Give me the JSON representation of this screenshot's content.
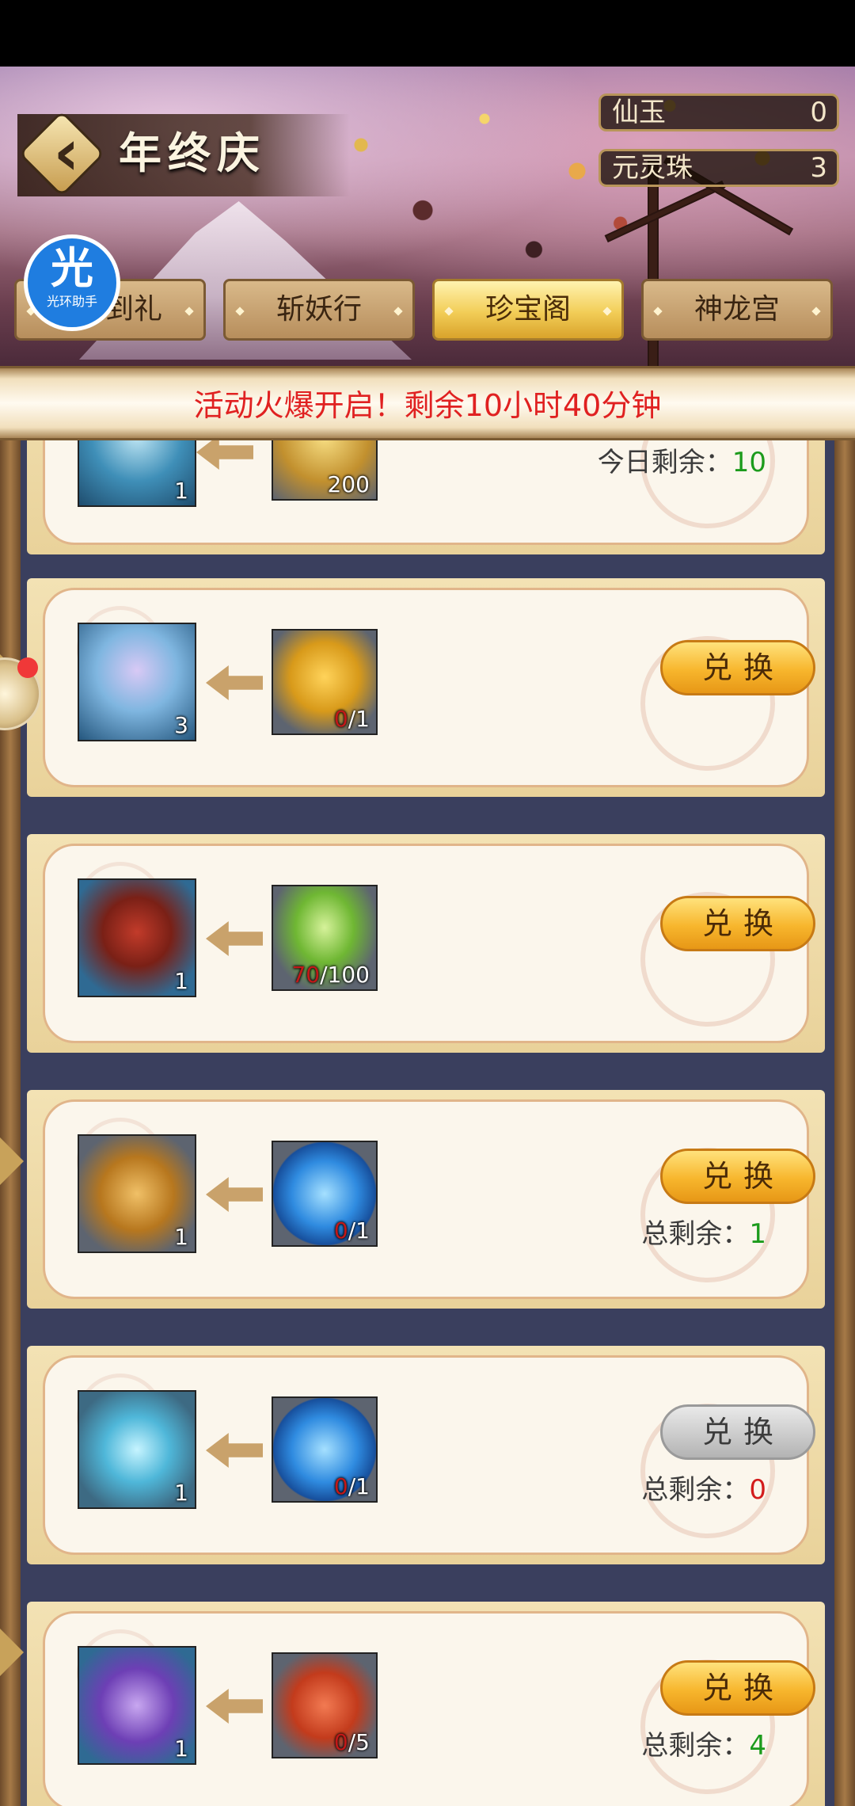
{
  "header": {
    "title": "年终庆",
    "currencies": [
      {
        "label": "仙玉",
        "value": "0"
      },
      {
        "label": "元灵珠",
        "value": "3"
      }
    ]
  },
  "helper_badge": {
    "glyph": "光",
    "label": "光环助手"
  },
  "tabs": [
    {
      "label": "到礼",
      "active": false
    },
    {
      "label": "斩妖行",
      "active": false
    },
    {
      "label": "珍宝阁",
      "active": true
    },
    {
      "label": "神龙宫",
      "active": false
    }
  ],
  "announcement": "活动火爆开启！剩余10小时40分钟",
  "items": [
    {
      "reward": {
        "name": "unknown-reward",
        "qty": "1"
      },
      "cost": {
        "name": "gold-coins",
        "have": "",
        "need": "200"
      },
      "button": null,
      "remain_label": "今日剩余：",
      "remain_value": "10",
      "remain_color": "green"
    },
    {
      "reward": {
        "name": "spirit-cloud",
        "qty": "3"
      },
      "cost": {
        "name": "golden-carp",
        "have": "0",
        "need": "/1"
      },
      "button": "兑换",
      "remain_label": "",
      "remain_value": "",
      "remain_color": ""
    },
    {
      "reward": {
        "name": "treasure-chest",
        "qty": "1"
      },
      "cost": {
        "name": "jade-leaf",
        "have": "70",
        "need": "/100"
      },
      "button": "兑换",
      "remain_label": "",
      "remain_value": "",
      "remain_color": ""
    },
    {
      "reward": {
        "name": "jade-pendant",
        "qty": "1"
      },
      "cost": {
        "name": "tiger-orb",
        "have": "0",
        "need": "/1"
      },
      "button": "兑换",
      "remain_label": "总剩余：",
      "remain_value": "1",
      "remain_color": "green"
    },
    {
      "reward": {
        "name": "spirit-fish",
        "qty": "1"
      },
      "cost": {
        "name": "tiger-orb",
        "have": "0",
        "need": "/1"
      },
      "button": "兑换",
      "button_disabled": true,
      "remain_label": "总剩余：",
      "remain_value": "0",
      "remain_color": "red"
    },
    {
      "reward": {
        "name": "lucky-bag",
        "qty": "1"
      },
      "cost": {
        "name": "red-fish",
        "have": "0",
        "need": "/5"
      },
      "button": "兑换",
      "remain_label": "总剩余：",
      "remain_value": "4",
      "remain_color": "green"
    }
  ]
}
